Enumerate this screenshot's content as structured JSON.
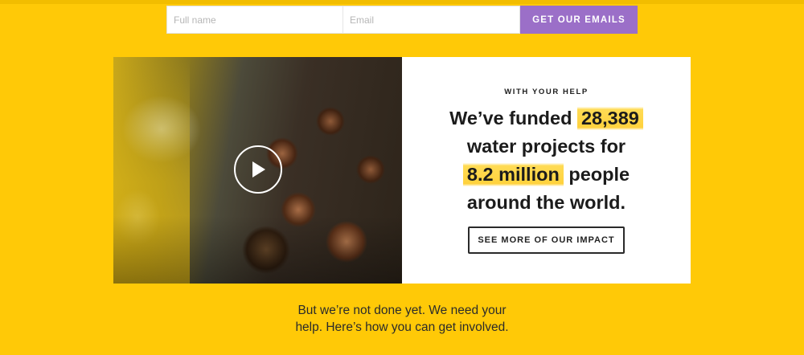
{
  "signup": {
    "name_placeholder": "Full name",
    "email_placeholder": "Email",
    "submit_label": "GET OUR EMAILS",
    "accent_color": "#9b6fc8"
  },
  "hero": {
    "video_play_icon": "play-icon",
    "kicker": "WITH YOUR HELP",
    "headline": {
      "part1": "We’ve funded",
      "projects_count": "28,389",
      "part2": "water projects for",
      "people_count": "8.2 million",
      "part3": "people",
      "part4": "around the world."
    },
    "impact_button_label": "SEE MORE OF OUR IMPACT"
  },
  "cta": {
    "line1": "But we’re not done yet. We need your",
    "line2": "help. Here’s how you can get involved."
  },
  "colors": {
    "background": "#ffc907",
    "highlight": "#ffd537",
    "text": "#1b1b1b"
  }
}
